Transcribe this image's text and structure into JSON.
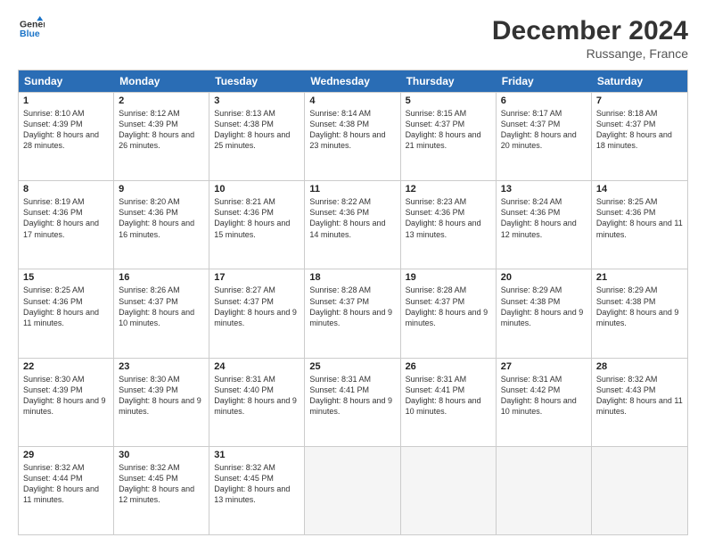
{
  "header": {
    "logo_line1": "General",
    "logo_line2": "Blue",
    "title": "December 2024",
    "subtitle": "Russange, France"
  },
  "days": [
    "Sunday",
    "Monday",
    "Tuesday",
    "Wednesday",
    "Thursday",
    "Friday",
    "Saturday"
  ],
  "weeks": [
    [
      {
        "day": "1",
        "rise": "Sunrise: 8:10 AM",
        "set": "Sunset: 4:39 PM",
        "daylight": "Daylight: 8 hours and 28 minutes."
      },
      {
        "day": "2",
        "rise": "Sunrise: 8:12 AM",
        "set": "Sunset: 4:39 PM",
        "daylight": "Daylight: 8 hours and 26 minutes."
      },
      {
        "day": "3",
        "rise": "Sunrise: 8:13 AM",
        "set": "Sunset: 4:38 PM",
        "daylight": "Daylight: 8 hours and 25 minutes."
      },
      {
        "day": "4",
        "rise": "Sunrise: 8:14 AM",
        "set": "Sunset: 4:38 PM",
        "daylight": "Daylight: 8 hours and 23 minutes."
      },
      {
        "day": "5",
        "rise": "Sunrise: 8:15 AM",
        "set": "Sunset: 4:37 PM",
        "daylight": "Daylight: 8 hours and 21 minutes."
      },
      {
        "day": "6",
        "rise": "Sunrise: 8:17 AM",
        "set": "Sunset: 4:37 PM",
        "daylight": "Daylight: 8 hours and 20 minutes."
      },
      {
        "day": "7",
        "rise": "Sunrise: 8:18 AM",
        "set": "Sunset: 4:37 PM",
        "daylight": "Daylight: 8 hours and 18 minutes."
      }
    ],
    [
      {
        "day": "8",
        "rise": "Sunrise: 8:19 AM",
        "set": "Sunset: 4:36 PM",
        "daylight": "Daylight: 8 hours and 17 minutes."
      },
      {
        "day": "9",
        "rise": "Sunrise: 8:20 AM",
        "set": "Sunset: 4:36 PM",
        "daylight": "Daylight: 8 hours and 16 minutes."
      },
      {
        "day": "10",
        "rise": "Sunrise: 8:21 AM",
        "set": "Sunset: 4:36 PM",
        "daylight": "Daylight: 8 hours and 15 minutes."
      },
      {
        "day": "11",
        "rise": "Sunrise: 8:22 AM",
        "set": "Sunset: 4:36 PM",
        "daylight": "Daylight: 8 hours and 14 minutes."
      },
      {
        "day": "12",
        "rise": "Sunrise: 8:23 AM",
        "set": "Sunset: 4:36 PM",
        "daylight": "Daylight: 8 hours and 13 minutes."
      },
      {
        "day": "13",
        "rise": "Sunrise: 8:24 AM",
        "set": "Sunset: 4:36 PM",
        "daylight": "Daylight: 8 hours and 12 minutes."
      },
      {
        "day": "14",
        "rise": "Sunrise: 8:25 AM",
        "set": "Sunset: 4:36 PM",
        "daylight": "Daylight: 8 hours and 11 minutes."
      }
    ],
    [
      {
        "day": "15",
        "rise": "Sunrise: 8:25 AM",
        "set": "Sunset: 4:36 PM",
        "daylight": "Daylight: 8 hours and 11 minutes."
      },
      {
        "day": "16",
        "rise": "Sunrise: 8:26 AM",
        "set": "Sunset: 4:37 PM",
        "daylight": "Daylight: 8 hours and 10 minutes."
      },
      {
        "day": "17",
        "rise": "Sunrise: 8:27 AM",
        "set": "Sunset: 4:37 PM",
        "daylight": "Daylight: 8 hours and 9 minutes."
      },
      {
        "day": "18",
        "rise": "Sunrise: 8:28 AM",
        "set": "Sunset: 4:37 PM",
        "daylight": "Daylight: 8 hours and 9 minutes."
      },
      {
        "day": "19",
        "rise": "Sunrise: 8:28 AM",
        "set": "Sunset: 4:37 PM",
        "daylight": "Daylight: 8 hours and 9 minutes."
      },
      {
        "day": "20",
        "rise": "Sunrise: 8:29 AM",
        "set": "Sunset: 4:38 PM",
        "daylight": "Daylight: 8 hours and 9 minutes."
      },
      {
        "day": "21",
        "rise": "Sunrise: 8:29 AM",
        "set": "Sunset: 4:38 PM",
        "daylight": "Daylight: 8 hours and 9 minutes."
      }
    ],
    [
      {
        "day": "22",
        "rise": "Sunrise: 8:30 AM",
        "set": "Sunset: 4:39 PM",
        "daylight": "Daylight: 8 hours and 9 minutes."
      },
      {
        "day": "23",
        "rise": "Sunrise: 8:30 AM",
        "set": "Sunset: 4:39 PM",
        "daylight": "Daylight: 8 hours and 9 minutes."
      },
      {
        "day": "24",
        "rise": "Sunrise: 8:31 AM",
        "set": "Sunset: 4:40 PM",
        "daylight": "Daylight: 8 hours and 9 minutes."
      },
      {
        "day": "25",
        "rise": "Sunrise: 8:31 AM",
        "set": "Sunset: 4:41 PM",
        "daylight": "Daylight: 8 hours and 9 minutes."
      },
      {
        "day": "26",
        "rise": "Sunrise: 8:31 AM",
        "set": "Sunset: 4:41 PM",
        "daylight": "Daylight: 8 hours and 10 minutes."
      },
      {
        "day": "27",
        "rise": "Sunrise: 8:31 AM",
        "set": "Sunset: 4:42 PM",
        "daylight": "Daylight: 8 hours and 10 minutes."
      },
      {
        "day": "28",
        "rise": "Sunrise: 8:32 AM",
        "set": "Sunset: 4:43 PM",
        "daylight": "Daylight: 8 hours and 11 minutes."
      }
    ],
    [
      {
        "day": "29",
        "rise": "Sunrise: 8:32 AM",
        "set": "Sunset: 4:44 PM",
        "daylight": "Daylight: 8 hours and 11 minutes."
      },
      {
        "day": "30",
        "rise": "Sunrise: 8:32 AM",
        "set": "Sunset: 4:45 PM",
        "daylight": "Daylight: 8 hours and 12 minutes."
      },
      {
        "day": "31",
        "rise": "Sunrise: 8:32 AM",
        "set": "Sunset: 4:45 PM",
        "daylight": "Daylight: 8 hours and 13 minutes."
      },
      null,
      null,
      null,
      null
    ]
  ]
}
